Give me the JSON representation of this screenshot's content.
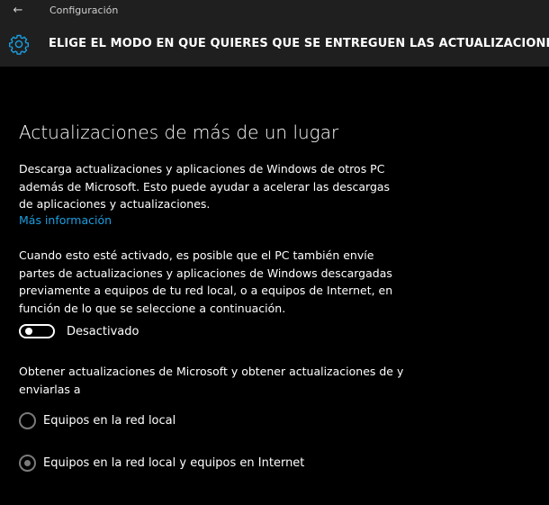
{
  "titlebar": {
    "back_icon": "back-arrow-icon",
    "title": "Configuración"
  },
  "header": {
    "icon": "gear-icon",
    "title": "ELIGE EL MODO EN QUE QUIERES QUE SE ENTREGUEN LAS ACTUALIZACIONES"
  },
  "main": {
    "section_title": "Actualizaciones de más de un lugar",
    "description": "Descarga actualizaciones y aplicaciones de Windows de otros PC además de Microsoft. Esto puede ayudar a acelerar las descargas de aplicaciones y actualizaciones.",
    "more_info_link": "Más información",
    "activation_note": "Cuando esto esté activado, es posible que el PC también envíe partes de actualizaciones y aplicaciones de Windows descargadas previamente a equipos de tu red local, o a equipos de Internet, en función de lo que se seleccione a continuación.",
    "toggle": {
      "state": "off",
      "label": "Desactivado"
    },
    "obtain_label": "Obtener actualizaciones de Microsoft y obtener actualizaciones de y enviarlas a",
    "options": [
      {
        "label": "Equipos en la red local",
        "selected": false
      },
      {
        "label": "Equipos en la red local y equipos en Internet",
        "selected": true
      }
    ]
  },
  "colors": {
    "background": "#000000",
    "header_background": "#1f1f1f",
    "accent_link": "#1a9fe0",
    "gear_icon": "#1a9fe0",
    "disabled_control": "#7a7a7a"
  }
}
